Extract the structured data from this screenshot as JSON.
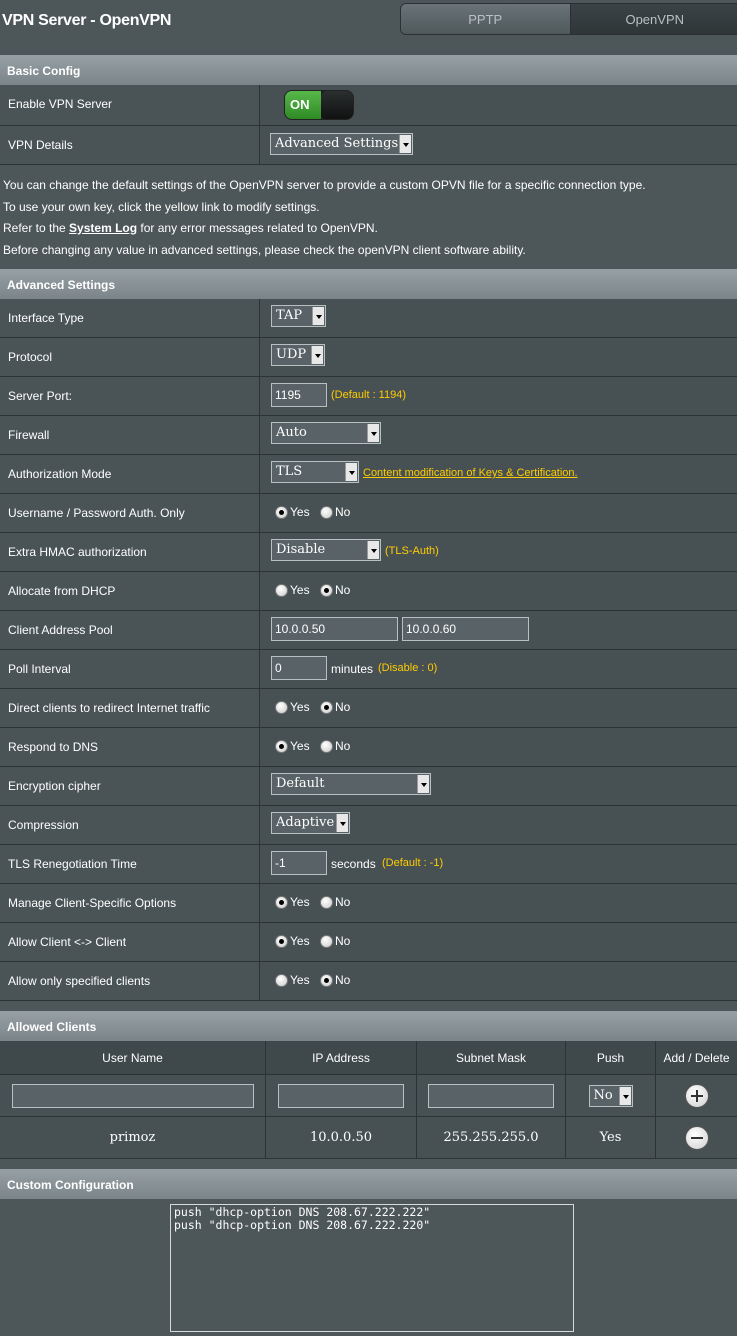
{
  "header": {
    "title": "VPN Server - OpenVPN",
    "tabs": [
      "PPTP",
      "OpenVPN"
    ]
  },
  "basic": {
    "section_title": "Basic Config",
    "enable_label": "Enable VPN Server",
    "enable_state": "ON",
    "details_label": "VPN Details",
    "details_value": "Advanced Settings"
  },
  "info": {
    "line1": "You can change the default settings of the OpenVPN server to provide a custom OPVN file for a specific connection type.",
    "line2": "To use your own key, click the yellow link to modify settings.",
    "line3_pre": "Refer to the ",
    "line3_link": "System Log",
    "line3_post": " for any error messages related to OpenVPN.",
    "line4": "Before changing any value in advanced settings, please check the openVPN client software ability."
  },
  "adv": {
    "section_title": "Advanced Settings",
    "interface_label": "Interface Type",
    "interface_value": "TAP",
    "protocol_label": "Protocol",
    "protocol_value": "UDP",
    "port_label": "Server Port:",
    "port_value": "1195",
    "port_hint": "(Default : 1194)",
    "firewall_label": "Firewall",
    "firewall_value": "Auto",
    "auth_label": "Authorization Mode",
    "auth_value": "TLS",
    "auth_link": "Content modification of Keys & Certification.",
    "userpass_label": "Username / Password Auth. Only",
    "hmac_label": "Extra HMAC authorization",
    "hmac_value": "Disable",
    "hmac_hint": "(TLS-Auth)",
    "dhcp_label": "Allocate from DHCP",
    "pool_label": "Client Address Pool",
    "pool_start": "10.0.0.50",
    "pool_end": "10.0.0.60",
    "poll_label": "Poll Interval",
    "poll_value": "0",
    "poll_unit": "minutes",
    "poll_hint": "(Disable : 0)",
    "redirect_label": "Direct clients to redirect Internet traffic",
    "dns_label": "Respond to DNS",
    "cipher_label": "Encryption cipher",
    "cipher_value": "Default",
    "compression_label": "Compression",
    "compression_value": "Adaptive",
    "tls_label": "TLS Renegotiation Time",
    "tls_value": "-1",
    "tls_unit": "seconds",
    "tls_hint": "(Default : -1)",
    "ccd_label": "Manage Client-Specific Options",
    "c2c_label": "Allow Client <-> Client",
    "only_label": "Allow only specified clients",
    "yes": "Yes",
    "no": "No"
  },
  "clients": {
    "section_title": "Allowed Clients",
    "headers": [
      "User Name",
      "IP Address",
      "Subnet Mask",
      "Push",
      "Add / Delete"
    ],
    "new_push": "No",
    "row": {
      "user": "primoz",
      "ip": "10.0.0.50",
      "mask": "255.255.255.0",
      "push": "Yes"
    }
  },
  "custom": {
    "section_title": "Custom Configuration",
    "text": "push \"dhcp-option DNS 208.67.222.222\"\npush \"dhcp-option DNS 208.67.222.220\""
  }
}
